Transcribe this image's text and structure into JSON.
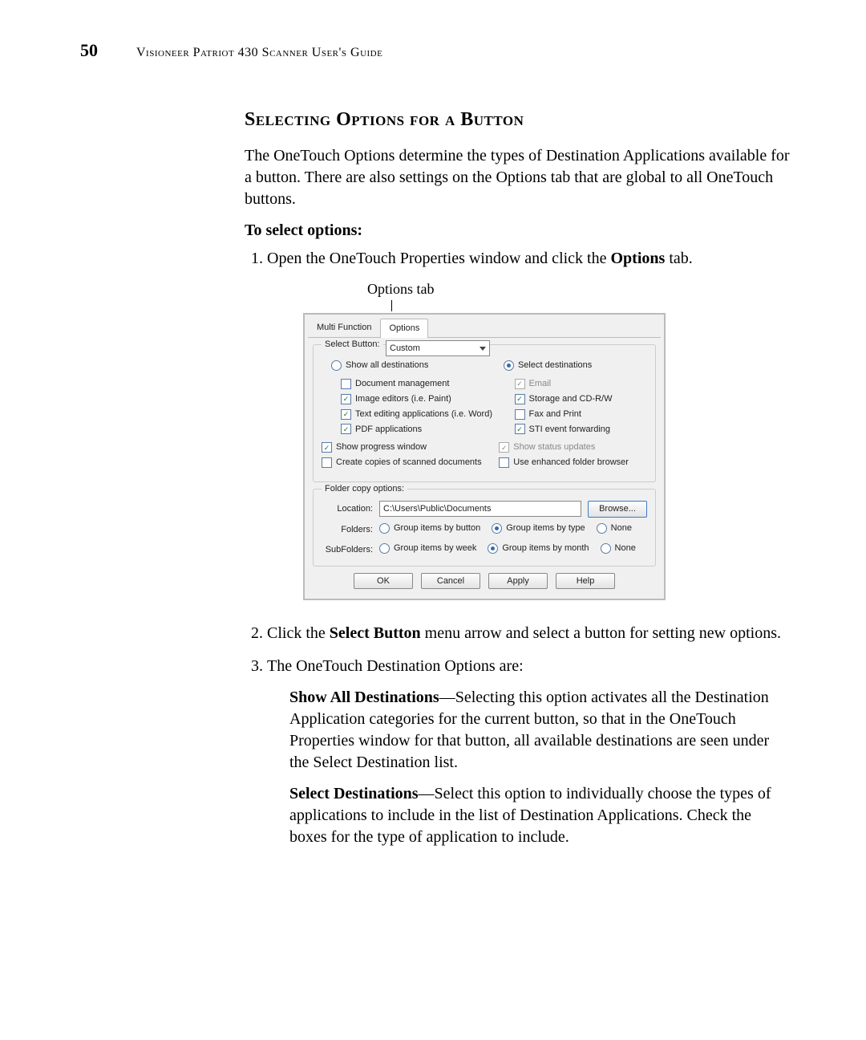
{
  "page_number": "50",
  "header_text": "Visioneer Patriot 430 Scanner User's Guide",
  "section_title": "Selecting Options for a Button",
  "intro_paragraph": "The OneTouch Options determine the types of Destination Applications available for a button. There are also settings on the Options tab that are global to all OneTouch buttons.",
  "to_select_options": "To select options:",
  "step_1_pre": "Open the OneTouch Properties window and click the ",
  "step_1_bold": "Options",
  "step_1_post": " tab.",
  "annotation": "Options tab",
  "dialog": {
    "tabs": {
      "multi": "Multi Function",
      "options": "Options"
    },
    "select_button_label": "Select Button:",
    "select_button_value": "Custom",
    "show_all": "Show all destinations",
    "select_dest": "Select destinations",
    "left": {
      "doc_mgmt": "Document management",
      "image_editors": "Image editors (i.e. Paint)",
      "text_editing": "Text editing applications (i.e. Word)",
      "pdf_apps": "PDF applications"
    },
    "right": {
      "email": "Email",
      "storage": "Storage and CD-R/W",
      "fax": "Fax and Print",
      "sti": "STI event forwarding"
    },
    "progress": "Show progress window",
    "status": "Show status updates",
    "copies": "Create copies of scanned documents",
    "enhanced": "Use enhanced folder browser",
    "folder_copy_title": "Folder copy options:",
    "location_label": "Location:",
    "location_value": "C:\\Users\\Public\\Documents",
    "browse": "Browse...",
    "folders_label": "Folders:",
    "folders": {
      "by_button": "Group items by button",
      "by_type": "Group items by type",
      "none": "None"
    },
    "subfolders_label": "SubFolders:",
    "subfolders": {
      "by_week": "Group items by week",
      "by_month": "Group items by month",
      "none": "None"
    },
    "buttons": {
      "ok": "OK",
      "cancel": "Cancel",
      "apply": "Apply",
      "help": "Help"
    }
  },
  "step_2_pre": "Click the ",
  "step_2_bold": "Select Button",
  "step_2_post": " menu arrow and select a button for setting new options.",
  "step_3": "The OneTouch Destination Options are:",
  "show_all_bold": "Show All Destinations",
  "show_all_desc": "—Selecting this option activates all the Destination Application categories for the current button, so that in the OneTouch Properties window for that button, all available destinations are seen under the Select Destination list.",
  "select_dest_bold": "Select Destinations",
  "select_dest_desc": "—Select this option to individually choose the types of applications to include in the list of Destination Applications. Check the boxes for the type of application to include."
}
